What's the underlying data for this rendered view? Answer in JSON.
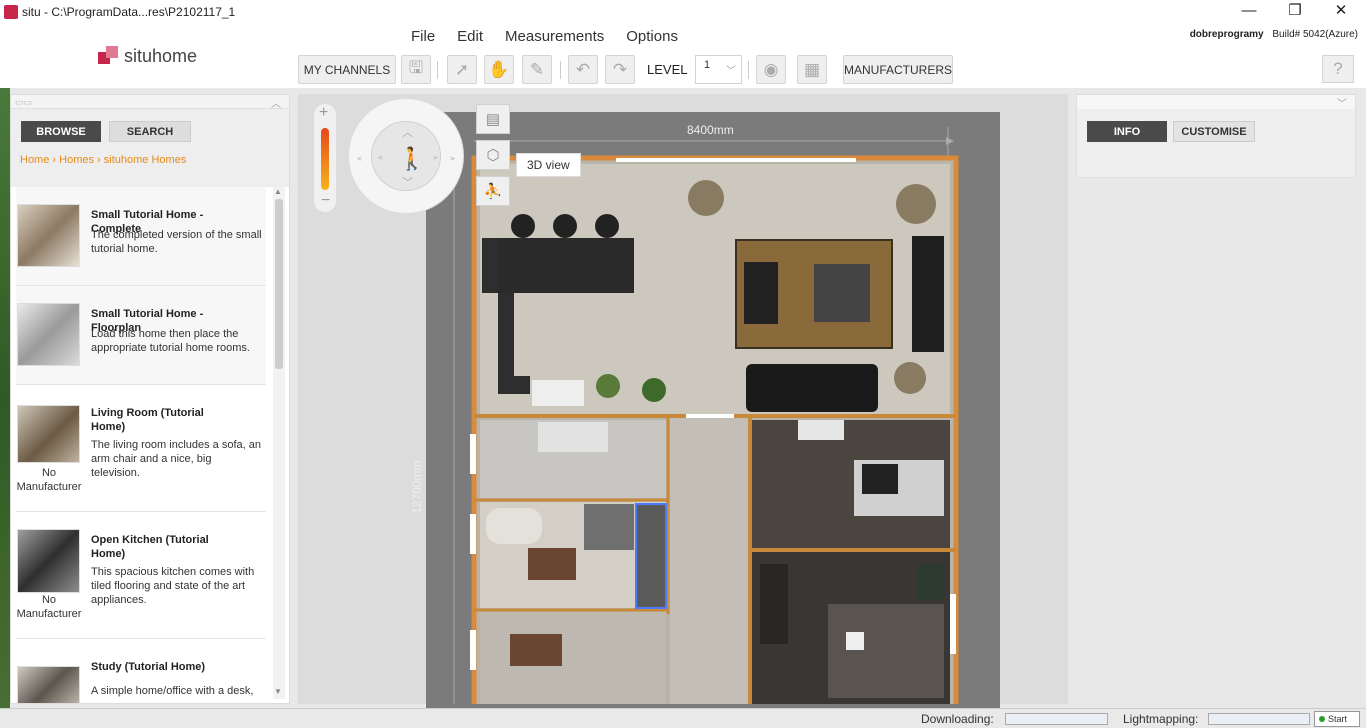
{
  "window": {
    "title": "situ - C:\\ProgramData...res\\P2102117_1",
    "minimize": "—",
    "restore": "❐",
    "close": "✕"
  },
  "header": {
    "logo_text": "situhome",
    "menu": [
      "File",
      "Edit",
      "Measurements",
      "Options"
    ],
    "user": "dobreprogramy",
    "build": "Build# 5042(Azure)"
  },
  "toolbar": {
    "my_channels": "MY CHANNELS",
    "level_label": "LEVEL",
    "level_value": "1",
    "manufacturers": "MANUFACTURERS",
    "help": "?"
  },
  "left_panel": {
    "tabs": [
      "BROWSE",
      "SEARCH"
    ],
    "breadcrumb": [
      "Home",
      "Homes",
      "situhome Homes"
    ],
    "items": [
      {
        "title": "Small Tutorial Home - Complete",
        "desc": "The completed version of the small tutorial home.",
        "manufacturer": ""
      },
      {
        "title": "Small Tutorial Home - Floorplan",
        "desc": "Load this home then place the appropriate tutorial home rooms.",
        "manufacturer": ""
      },
      {
        "title": "Living Room (Tutorial Home)",
        "desc": "The living room includes a sofa, an arm chair and a nice, big television.",
        "manufacturer": "No Manufacturer"
      },
      {
        "title": "Open Kitchen (Tutorial Home)",
        "desc": "This spacious kitchen comes with tiled flooring and state of the art appliances.",
        "manufacturer": "No Manufacturer"
      },
      {
        "title": "Study (Tutorial Home)",
        "desc": "A simple home/office with a desk,",
        "manufacturer": ""
      }
    ]
  },
  "canvas": {
    "tooltip": "3D view",
    "dim_width": "8400mm",
    "dim_height": "12700mm"
  },
  "right_panel": {
    "tabs": [
      "INFO",
      "CUSTOMISE"
    ]
  },
  "statusbar": {
    "downloading": "Downloading:",
    "lightmapping": "Lightmapping:",
    "start": "Start"
  }
}
